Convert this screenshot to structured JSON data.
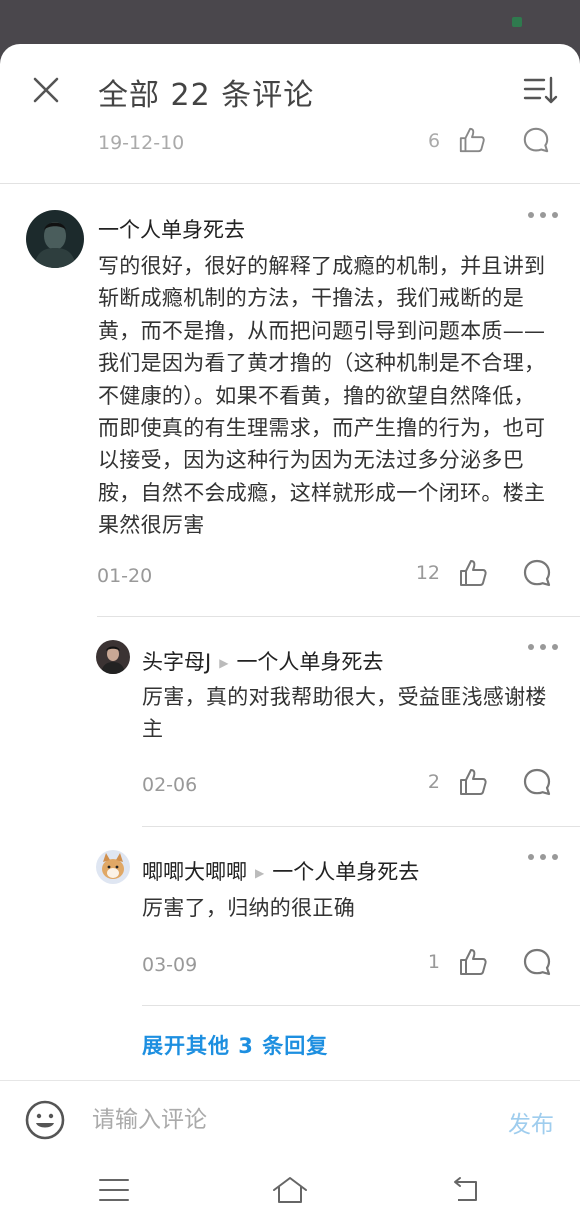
{
  "header": {
    "title": "全部 22 条评论"
  },
  "previous_comment": {
    "date": "19-12-10",
    "like_count": "6"
  },
  "main_comment": {
    "author": "一个人单身死去",
    "text": "写的很好，很好的解释了成瘾的机制，并且讲到斩断成瘾机制的方法，干撸法，我们戒断的是黄，而不是撸，从而把问题引导到问题本质——我们是因为看了黄才撸的（这种机制是不合理，不健康的）。如果不看黄，撸的欲望自然降低，而即使真的有生理需求，而产生撸的行为，也可以接受，因为这种行为因为无法过多分泌多巴胺，自然不会成瘾，这样就形成一个闭环。楼主果然很厉害",
    "date": "01-20",
    "like_count": "12"
  },
  "replies": [
    {
      "author": "头字母J",
      "reply_to": "一个人单身死去",
      "text": "厉害，真的对我帮助很大，受益匪浅感谢楼主",
      "date": "02-06",
      "like_count": "2"
    },
    {
      "author": "唧唧大唧唧",
      "reply_to": "一个人单身死去",
      "text": "厉害了，归纳的很正确",
      "date": "03-09",
      "like_count": "1"
    }
  ],
  "expand_replies": "展开其他 3 条回复",
  "input_bar": {
    "placeholder": "请输入评论",
    "send_label": "发布"
  },
  "icons": {
    "close": "close-icon",
    "sort": "sort-icon",
    "like": "thumbs-up-icon",
    "reply": "comment-bubble-icon",
    "more": "more-dots-icon",
    "emoji": "emoji-icon",
    "menu": "menu-icon",
    "home": "home-icon",
    "back": "back-icon"
  },
  "colors": {
    "accent": "#1d8fe0",
    "send_disabled": "#9fcdee",
    "backdrop": "#4a474c"
  }
}
